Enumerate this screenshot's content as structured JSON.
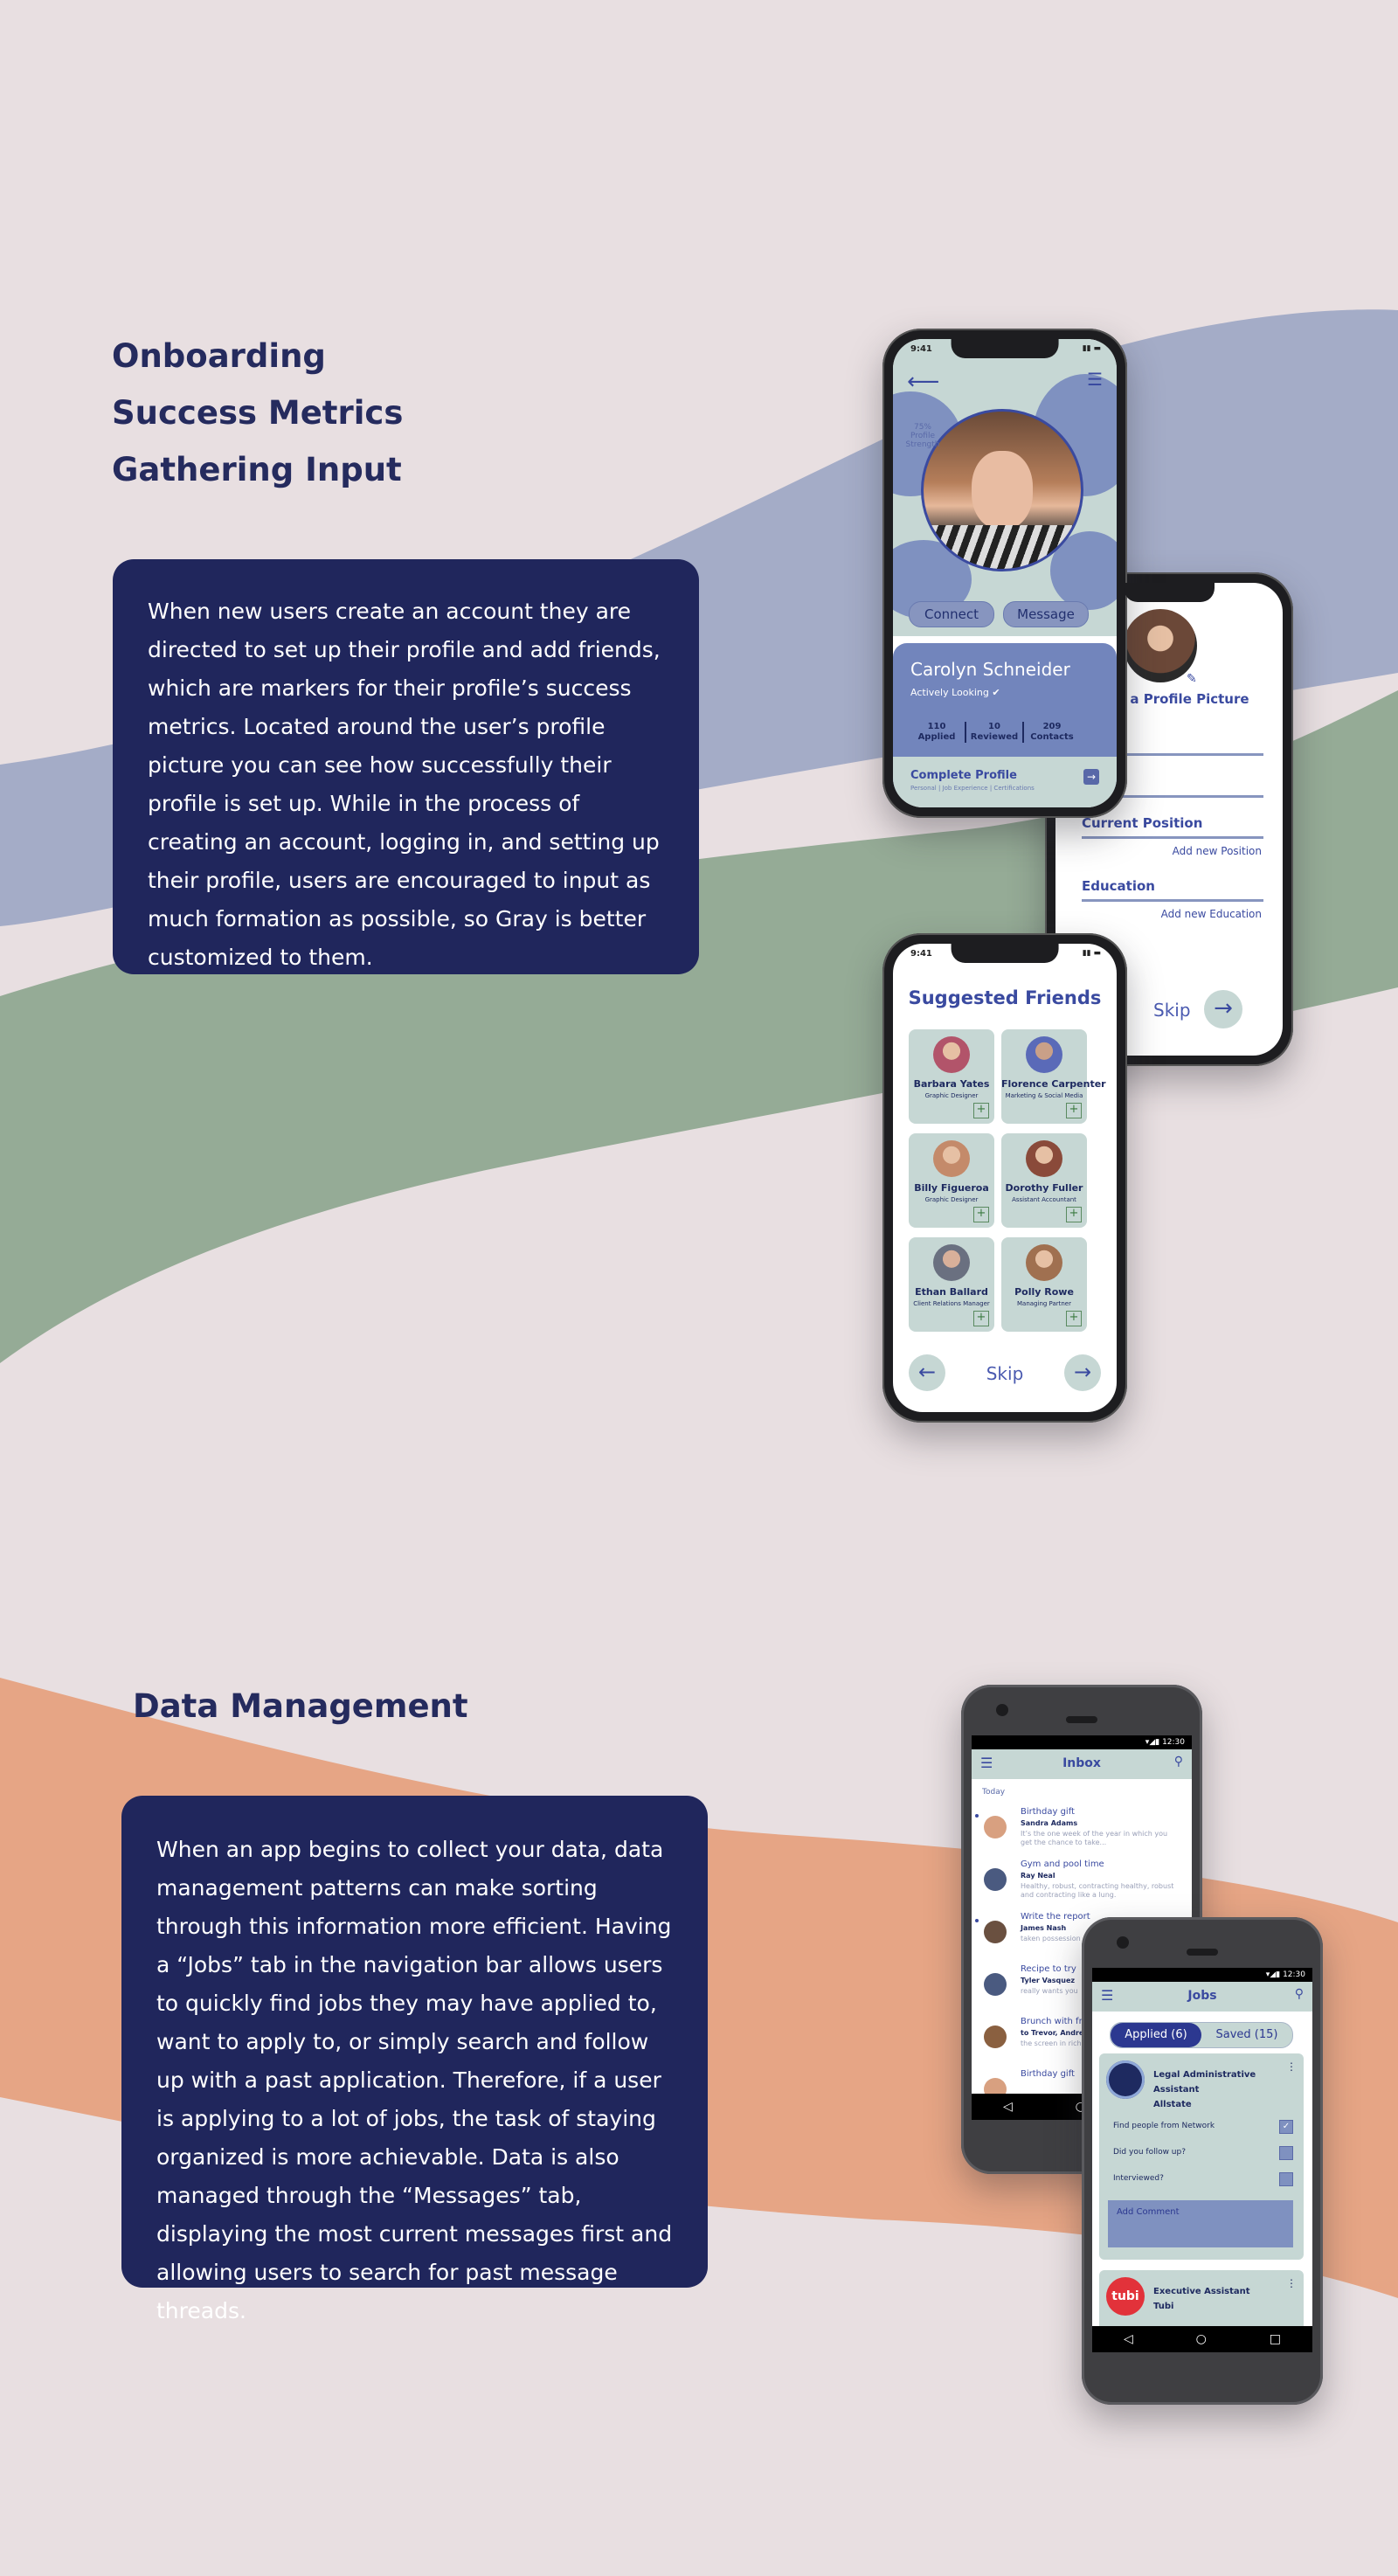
{
  "onboarding": {
    "headings": [
      "Onboarding",
      "Success Metrics",
      "Gathering Input"
    ],
    "paragraph": "When new users create an account they are directed to set up their profile and add friends, which are markers for their profile’s success metrics. Located around the user’s profile picture you can see how successfully their profile is set up. While in the process of creating an account, logging in, and setting up their profile, users are encouraged to input as much formation as possible, so Gray is better customized to them."
  },
  "data_management": {
    "heading": "Data Management",
    "paragraph": "When an app begins to collect your data, data management patterns can make sorting through this information more efficient.  Having a “Jobs” tab in the navigation bar allows users to quickly find jobs they may have applied to, want to apply to, or simply search and follow up with a past application.  Therefore, if a user is applying to a lot of jobs, the task of staying organized is more achievable.  Data is also managed through the “Messages” tab, displaying the most current messages first and allowing users to search for past message threads."
  },
  "profile_phone": {
    "time": "9:41",
    "profile_strength": "75% Profile Strength",
    "connect": "Connect",
    "message": "Message",
    "name": "Carolyn Schneider",
    "status": "Actively Looking",
    "stats": [
      {
        "value": "110",
        "label": "Applied"
      },
      {
        "value": "10",
        "label": "Reviewed"
      },
      {
        "value": "209",
        "label": "Contacts"
      }
    ],
    "complete_label": "Complete Profile",
    "complete_sub": "Personal | Job Experience | Certifications"
  },
  "setup_phone": {
    "title": "e a Profile Picture",
    "field1": "Current Position",
    "field1_add": "Add new Position",
    "field2": "Education",
    "field2_add": "Add new Education",
    "skip": "Skip"
  },
  "friends_phone": {
    "time": "9:41",
    "title": "Suggested Friends",
    "friends": [
      {
        "name": "Barbara Yates",
        "role": "Graphic Designer",
        "color": "#b2546a"
      },
      {
        "name": "Florence Carpenter",
        "role": "Marketing & Social Media",
        "color": "#5a6ab8"
      },
      {
        "name": "Billy Figueroa",
        "role": "Graphic Designer",
        "color": "#c48a6a"
      },
      {
        "name": "Dorothy Fuller",
        "role": "Assistant Accountant",
        "color": "#8a4a3a"
      },
      {
        "name": "Ethan Ballard",
        "role": "Client Relations Manager",
        "color": "#6a7080"
      },
      {
        "name": "Polly Rowe",
        "role": "Managing Partner",
        "color": "#a07050"
      }
    ],
    "skip": "Skip"
  },
  "inbox_phone": {
    "time": "12:30",
    "title": "Inbox",
    "section": "Today",
    "messages": [
      {
        "title": "Birthday gift",
        "sender": "Sandra Adams",
        "preview": "It’s the one week of the year in which you get the chance to take...",
        "color": "#d8a080"
      },
      {
        "title": "Gym and pool time",
        "sender": "Ray Neal",
        "preview": "Healthy, robust, contracting healthy, robust and contracting like a lung.",
        "color": "#4a5a80"
      },
      {
        "title": "Write the report",
        "sender": "James Nash",
        "preview": "taken possession",
        "color": "#6a5040"
      },
      {
        "title": "Recipe to try",
        "sender": "Tyler Vasquez",
        "preview": "really wants you",
        "color": "#4a5a80"
      },
      {
        "title": "Brunch with fr",
        "sender": "to Trevor, Andrew",
        "preview": "the screen in rich",
        "color": "#8a6040"
      },
      {
        "title": "Birthday gift",
        "sender": "",
        "preview": "",
        "color": "#d8a080"
      }
    ]
  },
  "jobs_phone": {
    "time": "12:30",
    "title": "Jobs",
    "tab_applied": "Applied (6)",
    "tab_saved": "Saved (15)",
    "job1_title": "Legal Administrative Assistant",
    "job1_company": "Allstate",
    "rows": [
      "Find people from Network",
      "Did you follow up?",
      "Interviewed?"
    ],
    "comment": "Add Comment",
    "job2_title": "Executive Assistant",
    "job2_company": "Tubi",
    "job2_logo": "tubi"
  }
}
